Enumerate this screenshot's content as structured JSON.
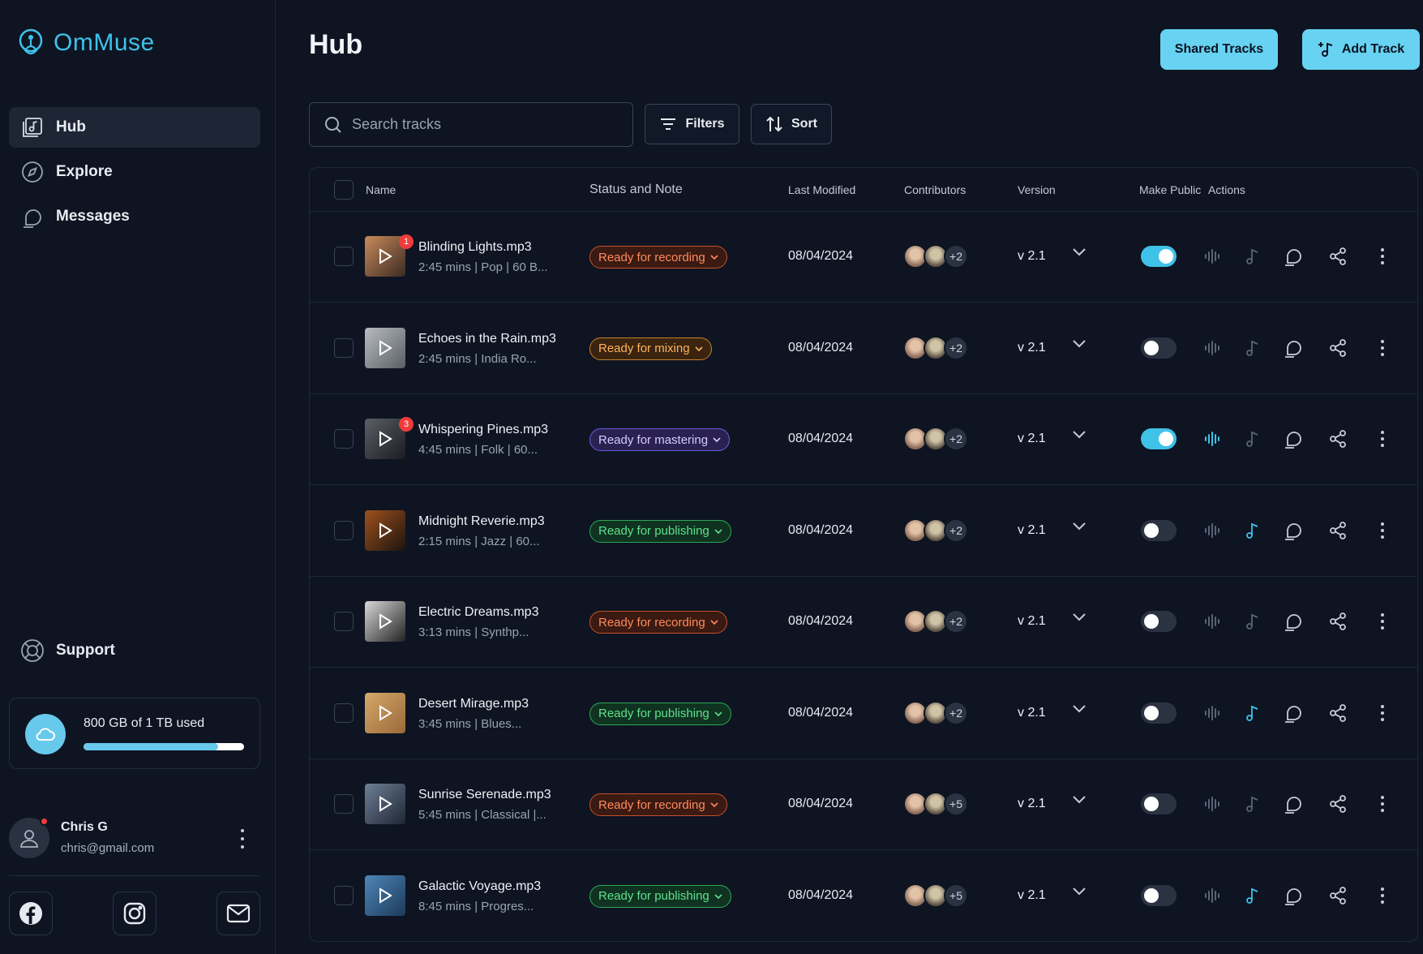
{
  "app": {
    "name": "OmMuse"
  },
  "sidebar": {
    "items": [
      {
        "label": "Hub",
        "icon": "music-folder-icon",
        "active": true
      },
      {
        "label": "Explore",
        "icon": "compass-icon",
        "active": false
      },
      {
        "label": "Messages",
        "icon": "chat-icon",
        "active": false
      }
    ],
    "support_label": "Support",
    "storage": {
      "text": "800 GB of 1 TB used",
      "used_fraction": 0.84
    },
    "user": {
      "name": "Chris G",
      "email": "chris@gmail.com"
    },
    "socials": [
      "facebook-icon",
      "instagram-icon",
      "mail-icon"
    ]
  },
  "header": {
    "title": "Hub",
    "shared_label": "Shared Tracks",
    "add_label": "Add Track"
  },
  "toolbar": {
    "search_placeholder": "Search tracks",
    "filters_label": "Filters",
    "sort_label": "Sort"
  },
  "table": {
    "columns": {
      "name": "Name",
      "status": "Status and Note",
      "modified": "Last Modified",
      "contributors": "Contributors",
      "version": "Version",
      "public": "Make Public",
      "actions": "Actions"
    },
    "rows": [
      {
        "name": "Blinding Lights.mp3",
        "meta": "2:45 mins | Pop | 60 B...",
        "badge": "1",
        "status": "Ready for recording",
        "status_kind": "recording",
        "date": "08/04/2024",
        "more": "+2",
        "version": "v 2.1",
        "public": true,
        "wave_active": false,
        "note_active": false
      },
      {
        "name": "Echoes in the Rain.mp3",
        "meta": "2:45 mins | India Ro...",
        "badge": "",
        "status": "Ready for mixing",
        "status_kind": "mixing",
        "date": "08/04/2024",
        "more": "+2",
        "version": "v 2.1",
        "public": false,
        "wave_active": false,
        "note_active": false
      },
      {
        "name": "Whispering Pines.mp3",
        "meta": "4:45 mins | Folk | 60...",
        "badge": "3",
        "status": "Ready for mastering",
        "status_kind": "mastering",
        "date": "08/04/2024",
        "more": "+2",
        "version": "v 2.1",
        "public": true,
        "wave_active": true,
        "note_active": false
      },
      {
        "name": "Midnight Reverie.mp3",
        "meta": "2:15 mins | Jazz | 60...",
        "badge": "",
        "status": "Ready for publishing",
        "status_kind": "publishing",
        "date": "08/04/2024",
        "more": "+2",
        "version": "v 2.1",
        "public": false,
        "wave_active": false,
        "note_active": true
      },
      {
        "name": "Electric Dreams.mp3",
        "meta": "3:13 mins | Synthp...",
        "badge": "",
        "status": "Ready for recording",
        "status_kind": "recording",
        "date": "08/04/2024",
        "more": "+2",
        "version": "v 2.1",
        "public": false,
        "wave_active": false,
        "note_active": false
      },
      {
        "name": "Desert Mirage.mp3",
        "meta": "3:45 mins | Blues...",
        "badge": "",
        "status": "Ready for publishing",
        "status_kind": "publishing",
        "date": "08/04/2024",
        "more": "+2",
        "version": "v 2.1",
        "public": false,
        "wave_active": false,
        "note_active": true
      },
      {
        "name": "Sunrise Serenade.mp3",
        "meta": "5:45 mins | Classical |...",
        "badge": "",
        "status": "Ready for recording",
        "status_kind": "recording",
        "date": "08/04/2024",
        "more": "+5",
        "version": "v 2.1",
        "public": false,
        "wave_active": false,
        "note_active": false
      },
      {
        "name": "Galactic Voyage.mp3",
        "meta": "8:45 mins | Progres...",
        "badge": "",
        "status": "Ready for publishing",
        "status_kind": "publishing",
        "date": "08/04/2024",
        "more": "+5",
        "version": "v 2.1",
        "public": false,
        "wave_active": false,
        "note_active": true
      }
    ]
  },
  "colors": {
    "accent": "#3ec2e8",
    "recording": "#f0683a",
    "mixing": "#f0a43a",
    "mastering": "#8b7cf6",
    "publishing": "#3ecf6e"
  }
}
